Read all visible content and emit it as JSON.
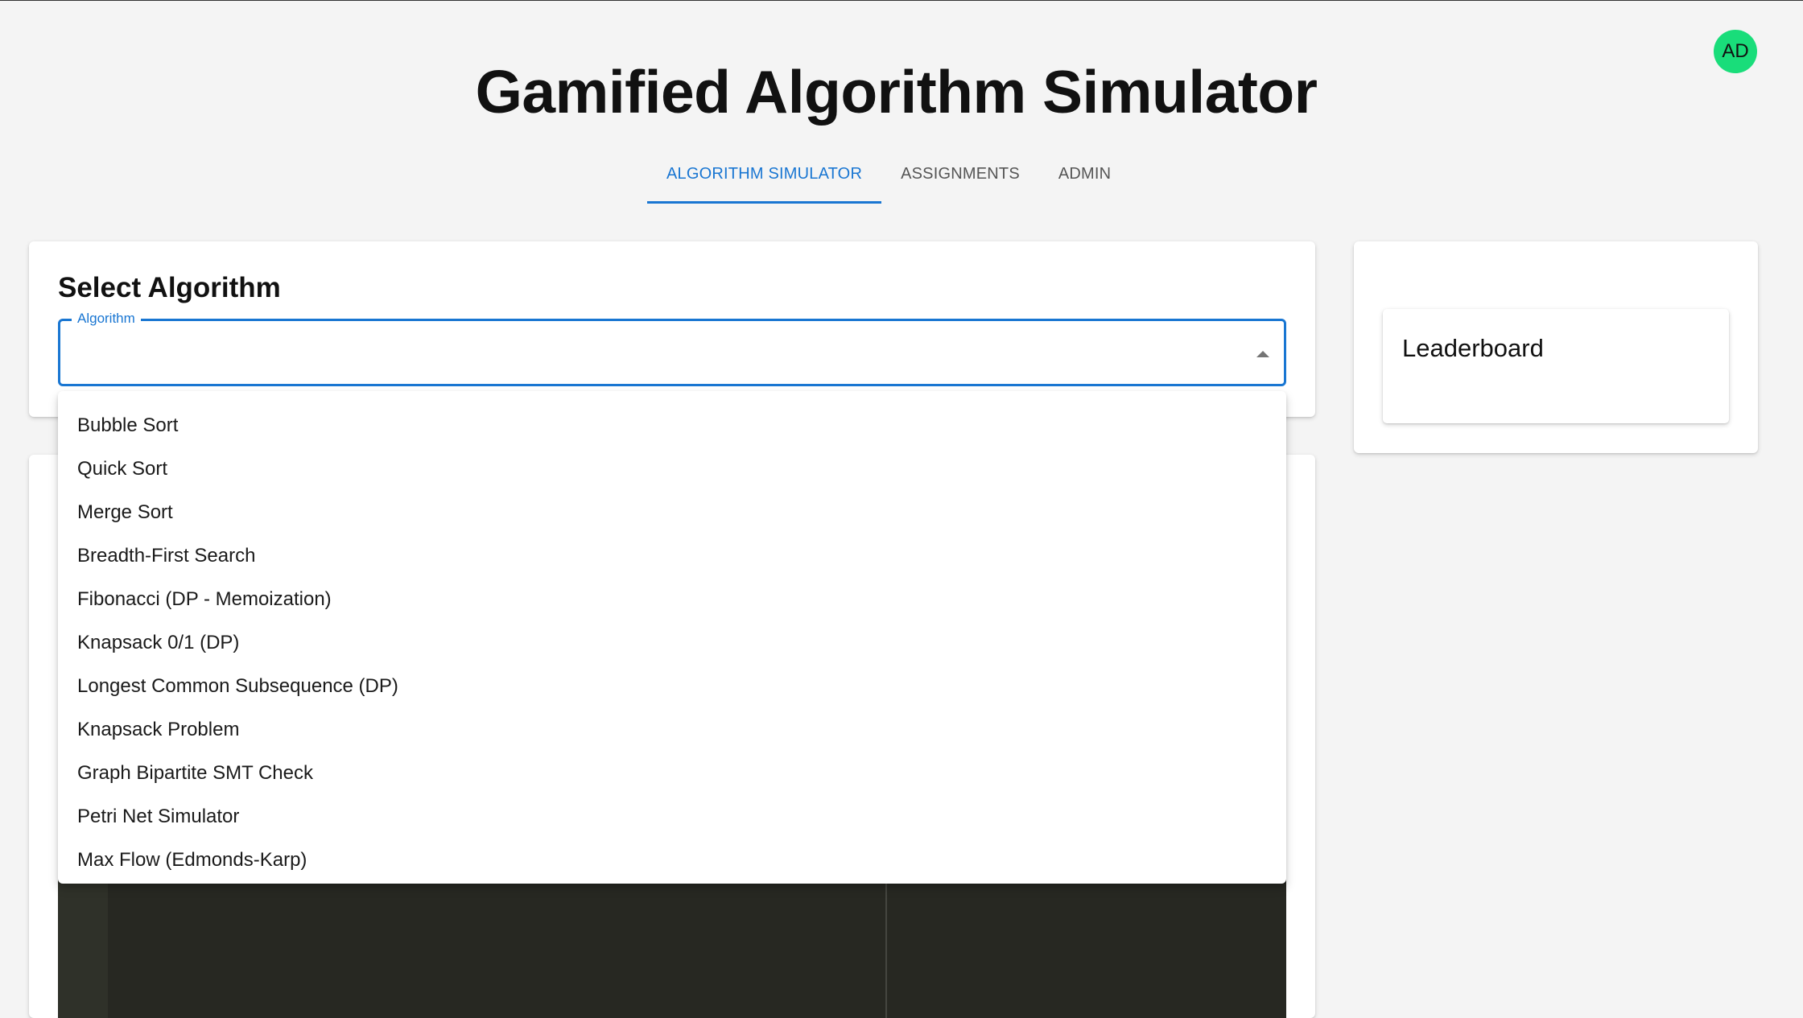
{
  "header": {
    "avatar_initials": "AD",
    "title": "Gamified Algorithm Simulator",
    "tabs": [
      {
        "label": "ALGORITHM SIMULATOR",
        "active": true
      },
      {
        "label": "ASSIGNMENTS",
        "active": false
      },
      {
        "label": "ADMIN",
        "active": false
      }
    ]
  },
  "select_card": {
    "heading": "Select Algorithm",
    "field_label": "Algorithm",
    "selected_value": ""
  },
  "dropdown": {
    "options": [
      "Bubble Sort",
      "Quick Sort",
      "Merge Sort",
      "Breadth-First Search",
      "Fibonacci (DP - Memoization)",
      "Knapsack 0/1 (DP)",
      "Longest Common Subsequence (DP)",
      "Knapsack Problem",
      "Graph Bipartite SMT Check",
      "Petri Net Simulator",
      "Max Flow (Edmonds-Karp)"
    ]
  },
  "sidebar": {
    "leaderboard_title": "Leaderboard"
  },
  "colors": {
    "accent": "#1976d2",
    "avatar": "#19dd7a",
    "background": "#f4f4f4",
    "editor": "#272822"
  }
}
